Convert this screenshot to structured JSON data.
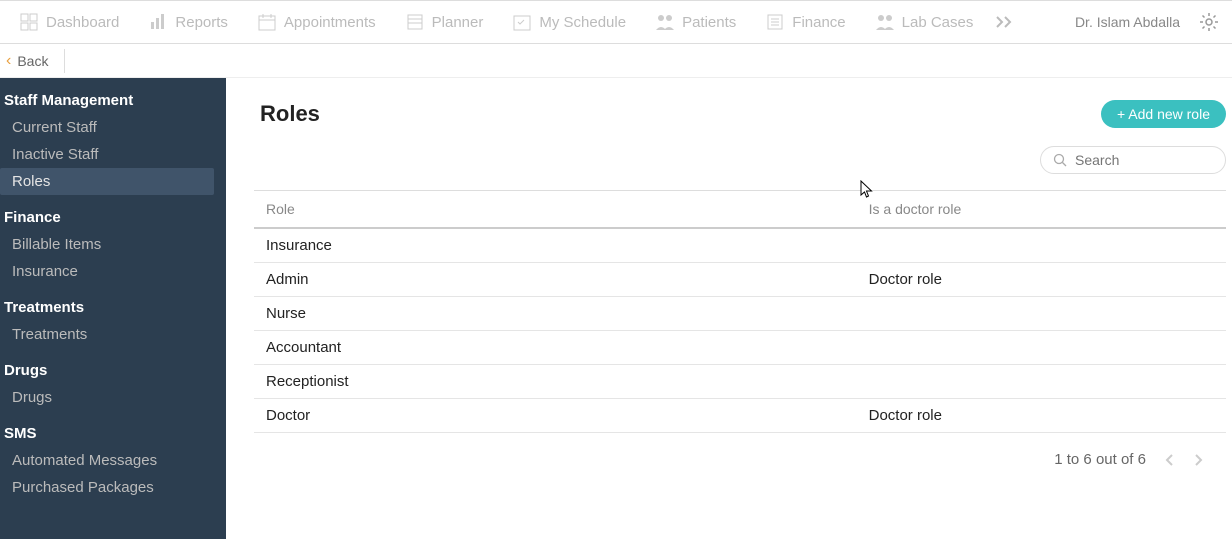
{
  "topnav": {
    "items": [
      {
        "label": "Dashboard"
      },
      {
        "label": "Reports"
      },
      {
        "label": "Appointments"
      },
      {
        "label": "Planner"
      },
      {
        "label": "My Schedule"
      },
      {
        "label": "Patients"
      },
      {
        "label": "Finance"
      },
      {
        "label": "Lab Cases"
      }
    ],
    "user": "Dr. Islam Abdalla"
  },
  "backbar": {
    "label": "Back"
  },
  "sidebar": {
    "sections": [
      {
        "title": "Staff Management",
        "items": [
          {
            "label": "Current Staff"
          },
          {
            "label": "Inactive Staff"
          },
          {
            "label": "Roles",
            "active": true
          }
        ]
      },
      {
        "title": "Finance",
        "items": [
          {
            "label": "Billable Items"
          },
          {
            "label": "Insurance"
          }
        ]
      },
      {
        "title": "Treatments",
        "items": [
          {
            "label": "Treatments"
          }
        ]
      },
      {
        "title": "Drugs",
        "items": [
          {
            "label": "Drugs"
          }
        ]
      },
      {
        "title": "SMS",
        "items": [
          {
            "label": "Automated Messages"
          },
          {
            "label": "Purchased Packages"
          }
        ]
      }
    ]
  },
  "main": {
    "title": "Roles",
    "add_button": "+ Add new role",
    "search_placeholder": "Search",
    "columns": {
      "role": "Role",
      "doctor": "Is a doctor role"
    },
    "rows": [
      {
        "role": "Insurance",
        "doctor": ""
      },
      {
        "role": "Admin",
        "doctor": "Doctor role"
      },
      {
        "role": "Nurse",
        "doctor": ""
      },
      {
        "role": "Accountant",
        "doctor": ""
      },
      {
        "role": "Receptionist",
        "doctor": ""
      },
      {
        "role": "Doctor",
        "doctor": "Doctor role"
      }
    ],
    "pagination": "1 to 6 out of 6"
  }
}
